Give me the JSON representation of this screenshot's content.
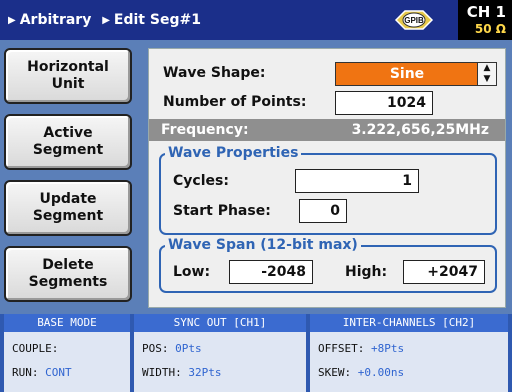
{
  "header": {
    "breadcrumb_1": "Arbitrary",
    "breadcrumb_2": "Edit Seg#1",
    "gpib_label": "GPIB",
    "channel": "CH 1",
    "impedance": "50 Ω"
  },
  "softkeys": [
    {
      "label": "Horizontal\nUnit"
    },
    {
      "label": "Active\nSegment"
    },
    {
      "label": "Update\nSegment"
    },
    {
      "label": "Delete\nSegments"
    }
  ],
  "form": {
    "wave_shape_label": "Wave Shape:",
    "wave_shape_value": "Sine",
    "num_points_label": "Number of Points:",
    "num_points_value": "1024",
    "frequency_label": "Frequency:",
    "frequency_value": "3.222,656,25MHz",
    "wave_properties": {
      "title": "Wave Properties",
      "cycles_label": "Cycles:",
      "cycles_value": "1",
      "start_phase_label": "Start Phase:",
      "start_phase_value": "0"
    },
    "wave_span": {
      "title": "Wave Span (12-bit max)",
      "low_label": "Low:",
      "low_value": "-2048",
      "high_label": "High:",
      "high_value": "+2047"
    }
  },
  "status": {
    "base_mode": {
      "title": "BASE MODE",
      "couple_label": "COUPLE:",
      "couple_value": "",
      "run_label": "RUN:",
      "run_value": "CONT"
    },
    "sync_out": {
      "title": "SYNC OUT [CH1]",
      "pos_label": "POS:",
      "pos_value": "0Pts",
      "width_label": "WIDTH:",
      "width_value": "32Pts"
    },
    "inter_channels": {
      "title": "INTER-CHANNELS [CH2]",
      "offset_label": "OFFSET:",
      "offset_value": "+8Pts",
      "skew_label": "SKEW:",
      "skew_value": "+0.00ns"
    }
  },
  "colors": {
    "header_bg": "#1b2f8a",
    "accent_orange": "#f07412",
    "group_blue": "#2f64b4",
    "value_blue": "#2f64d0",
    "impedance_yellow": "#ffd84a"
  }
}
